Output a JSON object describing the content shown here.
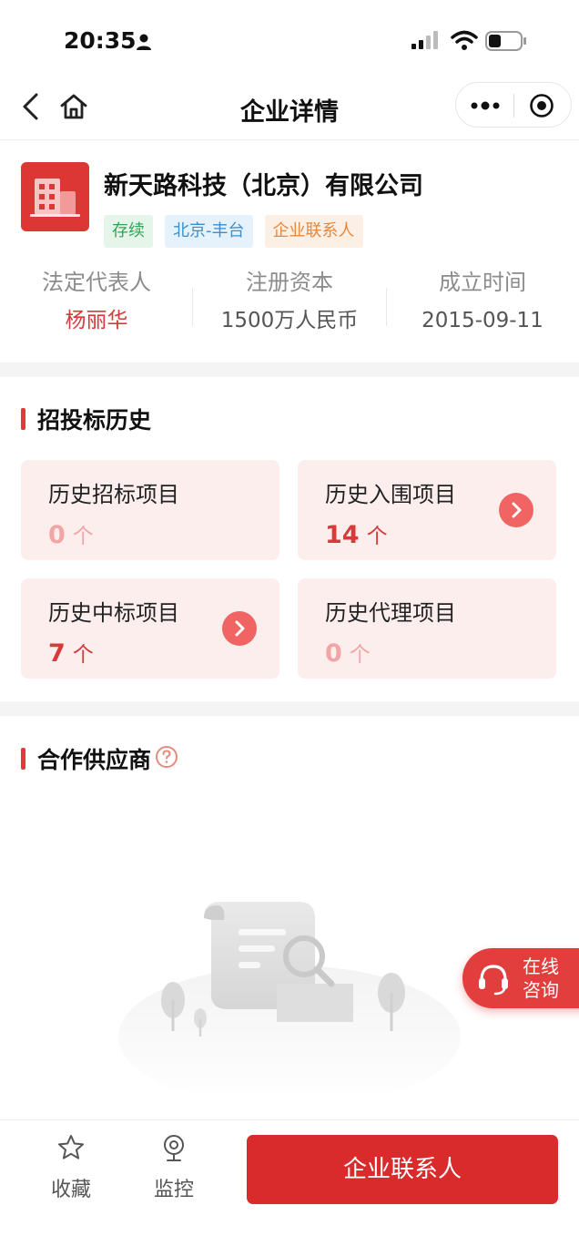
{
  "status_bar": {
    "time": "20:35",
    "icons": [
      "person-icon",
      "signal-icon",
      "wifi-icon",
      "battery-icon"
    ]
  },
  "nav": {
    "title": "企业详情",
    "icons": [
      "back-icon",
      "home-icon",
      "more-icon",
      "close-target-icon"
    ]
  },
  "company": {
    "name": "新天路科技（北京）有限公司",
    "tags": [
      {
        "label": "存续",
        "color": "#32a455"
      },
      {
        "label": "北京-丰台",
        "color": "#3a8fcf"
      },
      {
        "label": "企业联系人",
        "color": "#e6883d"
      }
    ],
    "stats": [
      {
        "label": "法定代表人",
        "value": "杨丽华"
      },
      {
        "label": "注册资本",
        "value": "1500万人民币"
      },
      {
        "label": "成立时间",
        "value": "2015-09-11"
      }
    ]
  },
  "bid_history": {
    "title": "招投标历史",
    "cards": [
      {
        "label": "历史招标项目",
        "count": "0",
        "unit": "个"
      },
      {
        "label": "历史入围项目",
        "count": "14",
        "unit": "个"
      },
      {
        "label": "历史中标项目",
        "count": "7",
        "unit": "个"
      },
      {
        "label": "历史代理项目",
        "count": "0",
        "unit": "个"
      }
    ]
  },
  "suppliers": {
    "title": "合作供应商"
  },
  "consult": {
    "line1": "在线",
    "line2": "咨询"
  },
  "bottom_bar": {
    "favorite_label": "收藏",
    "monitor_label": "监控",
    "primary_button": "企业联系人"
  },
  "colors": {
    "brand_red": "#d92b2b",
    "card_bg": "#fdeeee",
    "arrow_red": "#f06464"
  }
}
